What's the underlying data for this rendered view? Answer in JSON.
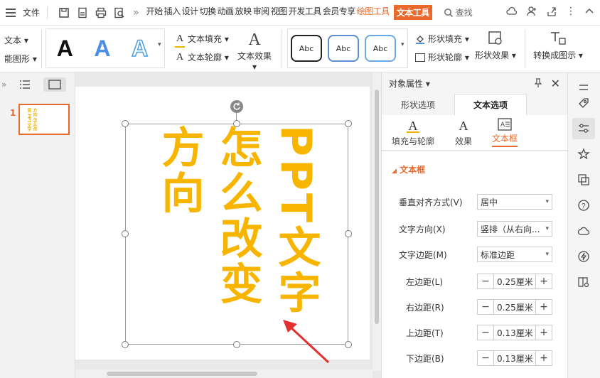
{
  "menu": {
    "file_label": "文件",
    "more": "»",
    "tabs": [
      "开始",
      "插入",
      "设计",
      "切换",
      "动画",
      "放映",
      "审阅",
      "视图",
      "开发工具",
      "会员专享"
    ],
    "drawing_tools": "绘图工具",
    "text_tools": "文本工具",
    "search": "查找"
  },
  "ribbon": {
    "left_text": "文本 ▾",
    "left_smart": "能图形 ▾",
    "wordart_sample": "A",
    "text_fill": "文本填充 ▾",
    "text_outline": "文本轮廓 ▾",
    "text_effect": "文本效果 ▾",
    "style_sample": "Abc",
    "shape_fill": "形状填充 ▾",
    "shape_outline": "形状轮廓 ▾",
    "shape_effect": "形状效果 ▾",
    "convert": "转换成图示 ▾"
  },
  "thumbnails": {
    "slide_number": "1",
    "thumb_text": "方向 怎么改变 PPT文字"
  },
  "slide": {
    "col1": "方向",
    "col2": "怎么改变",
    "col3": "PPT文字",
    "text_color": "#F7B500"
  },
  "panel": {
    "title": "对象属性 ▾",
    "tab_shape": "形状选项",
    "tab_text": "文本选项",
    "sub_fill": "填充与轮廓",
    "sub_effect": "效果",
    "sub_textbox": "文本框",
    "section": "文本框",
    "valign_label": "垂直对齐方式(V)",
    "valign_value": "居中",
    "direction_label": "文字方向(X)",
    "direction_value": "竖排（从右向...",
    "margin_label": "文字边距(M)",
    "margin_value": "标准边距",
    "left_label": "左边距(L)",
    "left_value": "0.25厘米",
    "right_label": "右边距(R)",
    "right_value": "0.25厘米",
    "top_label": "上边距(T)",
    "top_value": "0.13厘米",
    "bottom_label": "下边距(B)",
    "bottom_value": "0.13厘米",
    "accent": "#E86A2C"
  }
}
